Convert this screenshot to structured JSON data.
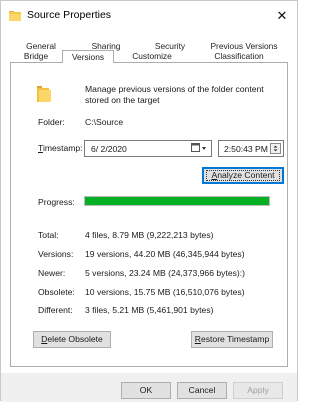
{
  "window": {
    "title": "Source Properties",
    "close_glyph": "✕"
  },
  "tabs_top": [
    {
      "label": "General"
    },
    {
      "label": "Sharing"
    },
    {
      "label": "Security"
    },
    {
      "label": "Previous Versions"
    }
  ],
  "tabs_bottom": [
    {
      "label": "Bridge"
    },
    {
      "label": "Versions",
      "active": true
    },
    {
      "label": "Customize"
    },
    {
      "label": "Classification"
    }
  ],
  "description": "Manage previous versions of the folder content stored on the target",
  "folder": {
    "label": "Folder:",
    "value": "C:\\Source"
  },
  "timestamp": {
    "label_accel": "T",
    "label_rest": "imestamp:",
    "date": "6/ 2/2020",
    "time": "2:50:43 PM"
  },
  "analyze_button": {
    "accel": "A",
    "rest": "nalyze Content"
  },
  "progress": {
    "label": "Progress:",
    "value": 1.0,
    "color": "#06b025"
  },
  "stats": [
    {
      "label": "Total:",
      "value": "4 files, 8.79 MB (9,222,213 bytes)"
    },
    {
      "label": "Versions:",
      "value": "19 versions, 44.20 MB (46,345,944 bytes)"
    },
    {
      "label": "Newer:",
      "value": "5 versions, 23.24 MB (24,373,966 bytes):)"
    },
    {
      "label": "Obsolete:",
      "value": "10 versions, 15.75 MB (16,510,076 bytes)"
    },
    {
      "label": "Different:",
      "value": "3 files, 5.21 MB (5,461,901 bytes)"
    }
  ],
  "delete_button": {
    "accel": "D",
    "rest": "elete Obsolete"
  },
  "restore_button": {
    "accel": "R",
    "rest": "estore Timestamp"
  },
  "footer": {
    "ok": "OK",
    "cancel": "Cancel",
    "apply": "Apply"
  },
  "icons": {
    "title": "folder-icon",
    "big": "folder-icon",
    "calendar": "calendar-dropdown-icon",
    "spin": "spin-up-down-icon"
  }
}
